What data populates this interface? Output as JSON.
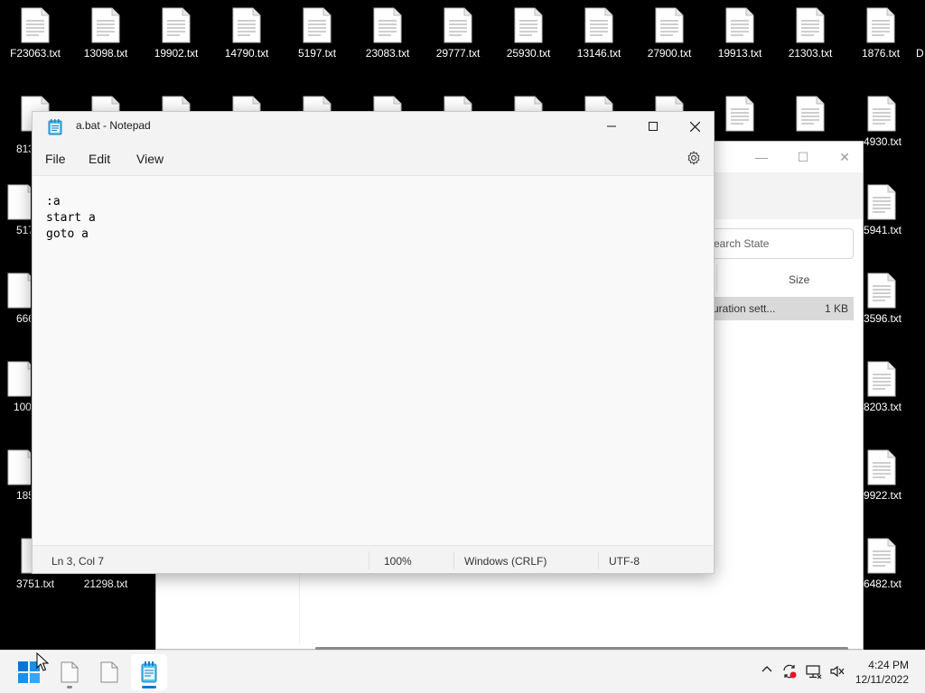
{
  "desktop": {
    "row1": [
      "F23063.txt",
      "13098.txt",
      "19902.txt",
      "14790.txt",
      "5197.txt",
      "23083.txt",
      "29777.txt",
      "25930.txt",
      "13146.txt",
      "27900.txt",
      "19913.txt",
      "21303.txt",
      "1876.txt",
      "D"
    ],
    "left_partial": [
      "813",
      "517",
      "666",
      "100",
      "185"
    ],
    "right_partial": [
      "4930.txt",
      "5941.txt",
      "3596.txt",
      "8203.txt",
      "9922.txt",
      "6482.txt"
    ],
    "bottom_left": [
      "3751.txt",
      "21298.txt"
    ]
  },
  "explorer": {
    "search_placeholder": "earch State",
    "column_size": "Size",
    "row_name": "uration sett...",
    "row_size": "1 KB",
    "minimize_glyph": "—",
    "maximize_glyph": "☐",
    "close_glyph": "✕"
  },
  "notepad": {
    "title": "a.bat - Notepad",
    "menu": {
      "file": "File",
      "edit": "Edit",
      "view": "View"
    },
    "lines": [
      ":a",
      "start a",
      "goto a"
    ],
    "status": {
      "position": "Ln 3, Col 7",
      "zoom": "100%",
      "line_ending": "Windows (CRLF)",
      "encoding": "UTF-8"
    }
  },
  "taskbar": {
    "time": "4:24 PM",
    "date": "12/11/2022",
    "accent": "#0078d4"
  }
}
